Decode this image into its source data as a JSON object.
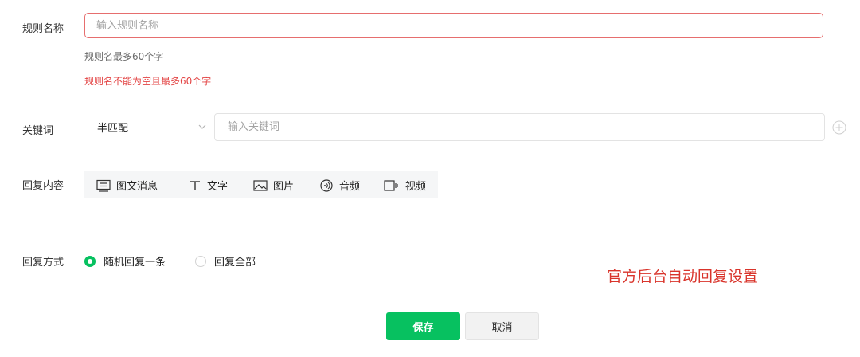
{
  "rule_name": {
    "label": "规则名称",
    "placeholder": "输入规则名称",
    "hint": "规则名最多60个字",
    "error": "规则名不能为空且最多60个字"
  },
  "keyword": {
    "label": "关键词",
    "match_mode": "半匹配",
    "placeholder": "输入关键词"
  },
  "reply_content": {
    "label": "回复内容",
    "types": [
      {
        "label": "图文消息",
        "icon": "news-icon"
      },
      {
        "label": "文字",
        "icon": "text-icon"
      },
      {
        "label": "图片",
        "icon": "image-icon"
      },
      {
        "label": "音频",
        "icon": "audio-icon"
      },
      {
        "label": "视频",
        "icon": "video-icon"
      }
    ]
  },
  "reply_mode": {
    "label": "回复方式",
    "options": [
      {
        "label": "随机回复一条",
        "selected": true
      },
      {
        "label": "回复全部",
        "selected": false
      }
    ]
  },
  "watermark": "官方后台自动回复设置",
  "buttons": {
    "save": "保存",
    "cancel": "取消"
  },
  "colors": {
    "accent": "#07c160",
    "error": "#e34545",
    "watermark": "#d9342b"
  }
}
